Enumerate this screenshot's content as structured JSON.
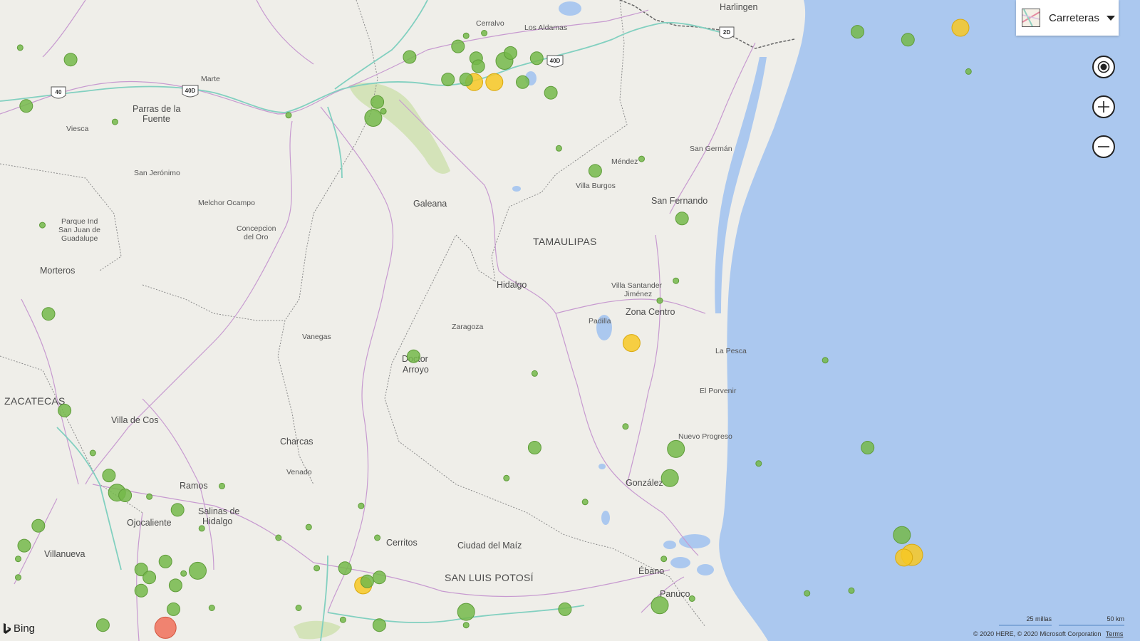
{
  "colors": {
    "water": "#abc8ef",
    "land": "#efeee9",
    "highway": "#82d0c0",
    "road": "#c79ad0",
    "state_border": "#8a8a8a",
    "marker_green": "#74b84a",
    "marker_yellow": "#f7c824",
    "marker_red": "#f0705a",
    "park": "#cfe0b0"
  },
  "map_style": {
    "label": "Carreteras",
    "icon": "road-map-thumbnail-icon"
  },
  "nav_controls": [
    {
      "name": "locate-me-button",
      "icon": "target-icon"
    },
    {
      "name": "zoom-in-button",
      "icon": "plus-icon"
    },
    {
      "name": "zoom-out-button",
      "icon": "minus-icon"
    }
  ],
  "labels": {
    "states": [
      "TAMAULIPAS",
      "ZACATECAS",
      "SAN LUIS POTOSÍ"
    ],
    "cities": [
      "Harlingen",
      "Parras de la",
      "Fuente",
      "Galeana",
      "San Fernando",
      "Hidalgo",
      "Zona Centro",
      "Morteros",
      "Doctor",
      "Arroyo",
      "Villa de Cos",
      "Charcas",
      "Ramos",
      "Salinas de",
      "Hidalgo",
      "Ojocaliente",
      "Villanueva",
      "Cerritos",
      "Ciudad del Maíz",
      "Ébano",
      "Panuco",
      "González"
    ],
    "towns": [
      "Cerralvo",
      "Los Aldamas",
      "Marte",
      "Viesca",
      "San Jerónimo",
      "Melchor Ocampo",
      "Parque Ind",
      "San Juan de",
      "Guadalupe",
      "Concepcion",
      "del Oro",
      "Méndez",
      "Villa Burgos",
      "San Germán",
      "Villa Santander",
      "Jiménez",
      "Padilla",
      "Vanegas",
      "Zaragoza",
      "La Pesca",
      "El Porvenir",
      "Nuevo Progreso",
      "Venado"
    ]
  },
  "shields": [
    "40",
    "40D",
    "40D",
    "2D"
  ],
  "markers": [
    {
      "lat": 26.21,
      "lon": -97.69,
      "size": 3,
      "level": "yellow"
    },
    {
      "lat": 26.12,
      "lon": -97.95,
      "size": 2,
      "level": "green"
    },
    {
      "lat": 26.18,
      "lon": -98.2,
      "size": 2,
      "level": "green"
    },
    {
      "lat": 25.88,
      "lon": -97.65,
      "size": 1,
      "level": "green"
    },
    {
      "lat": 25.8,
      "lon": -100.1,
      "size": 3,
      "level": "yellow"
    },
    {
      "lat": 25.8,
      "lon": -100.0,
      "size": 3,
      "level": "yellow"
    },
    {
      "lat": 25.96,
      "lon": -99.95,
      "size": 3,
      "level": "green"
    },
    {
      "lat": 26.02,
      "lon": -99.92,
      "size": 2,
      "level": "green"
    },
    {
      "lat": 26.07,
      "lon": -100.18,
      "size": 2,
      "level": "green"
    },
    {
      "lat": 26.15,
      "lon": -100.14,
      "size": 1,
      "level": "green"
    },
    {
      "lat": 26.17,
      "lon": -100.05,
      "size": 1,
      "level": "green"
    },
    {
      "lat": 25.98,
      "lon": -100.09,
      "size": 2,
      "level": "green"
    },
    {
      "lat": 25.92,
      "lon": -100.08,
      "size": 2,
      "level": "green"
    },
    {
      "lat": 25.82,
      "lon": -100.23,
      "size": 2,
      "level": "green"
    },
    {
      "lat": 25.82,
      "lon": -100.14,
      "size": 2,
      "level": "green"
    },
    {
      "lat": 25.8,
      "lon": -99.86,
      "size": 2,
      "level": "green"
    },
    {
      "lat": 25.72,
      "lon": -99.72,
      "size": 2,
      "level": "green"
    },
    {
      "lat": 25.98,
      "lon": -99.79,
      "size": 2,
      "level": "green"
    },
    {
      "lat": 25.99,
      "lon": -100.42,
      "size": 2,
      "level": "green"
    },
    {
      "lat": 25.65,
      "lon": -100.58,
      "size": 2,
      "level": "green"
    },
    {
      "lat": 25.53,
      "lon": -100.6,
      "size": 3,
      "level": "green"
    },
    {
      "lat": 25.58,
      "lon": -100.55,
      "size": 1,
      "level": "green"
    },
    {
      "lat": 25.3,
      "lon": -99.68,
      "size": 1,
      "level": "green"
    },
    {
      "lat": 25.13,
      "lon": -99.5,
      "size": 2,
      "level": "green"
    },
    {
      "lat": 25.22,
      "lon": -99.27,
      "size": 1,
      "level": "green"
    },
    {
      "lat": 24.77,
      "lon": -99.07,
      "size": 2,
      "level": "green"
    },
    {
      "lat": 25.97,
      "lon": -102.1,
      "size": 2,
      "level": "green"
    },
    {
      "lat": 25.62,
      "lon": -102.32,
      "size": 2,
      "level": "green"
    },
    {
      "lat": 25.5,
      "lon": -101.88,
      "size": 1,
      "level": "green"
    },
    {
      "lat": 26.06,
      "lon": -102.35,
      "size": 1,
      "level": "green"
    },
    {
      "lat": 25.55,
      "lon": -101.02,
      "size": 1,
      "level": "green"
    },
    {
      "lat": 24.72,
      "lon": -102.24,
      "size": 1,
      "level": "green"
    },
    {
      "lat": 24.05,
      "lon": -102.21,
      "size": 2,
      "level": "green"
    },
    {
      "lat": 23.32,
      "lon": -102.13,
      "size": 2,
      "level": "green"
    },
    {
      "lat": 23.0,
      "lon": -101.99,
      "size": 1,
      "level": "green"
    },
    {
      "lat": 22.83,
      "lon": -101.91,
      "size": 2,
      "level": "green"
    },
    {
      "lat": 22.7,
      "lon": -101.87,
      "size": 3,
      "level": "green"
    },
    {
      "lat": 22.68,
      "lon": -101.83,
      "size": 2,
      "level": "green"
    },
    {
      "lat": 22.67,
      "lon": -101.71,
      "size": 1,
      "level": "green"
    },
    {
      "lat": 22.75,
      "lon": -101.35,
      "size": 1,
      "level": "green"
    },
    {
      "lat": 22.57,
      "lon": -101.57,
      "size": 2,
      "level": "green"
    },
    {
      "lat": 22.45,
      "lon": -102.26,
      "size": 2,
      "level": "green"
    },
    {
      "lat": 22.3,
      "lon": -102.33,
      "size": 2,
      "level": "green"
    },
    {
      "lat": 22.2,
      "lon": -102.36,
      "size": 1,
      "level": "green"
    },
    {
      "lat": 22.43,
      "lon": -101.45,
      "size": 1,
      "level": "green"
    },
    {
      "lat": 22.18,
      "lon": -101.63,
      "size": 2,
      "level": "green"
    },
    {
      "lat": 22.11,
      "lon": -101.47,
      "size": 3,
      "level": "green"
    },
    {
      "lat": 22.09,
      "lon": -101.54,
      "size": 1,
      "level": "green"
    },
    {
      "lat": 22.12,
      "lon": -101.75,
      "size": 2,
      "level": "green"
    },
    {
      "lat": 22.06,
      "lon": -101.71,
      "size": 2,
      "level": "green"
    },
    {
      "lat": 21.96,
      "lon": -101.75,
      "size": 2,
      "level": "green"
    },
    {
      "lat": 22.0,
      "lon": -101.58,
      "size": 2,
      "level": "green"
    },
    {
      "lat": 21.83,
      "lon": -101.4,
      "size": 1,
      "level": "green"
    },
    {
      "lat": 21.82,
      "lon": -101.59,
      "size": 2,
      "level": "green"
    },
    {
      "lat": 21.7,
      "lon": -101.94,
      "size": 2,
      "level": "green"
    },
    {
      "lat": 21.68,
      "lon": -101.63,
      "size": 4,
      "level": "red"
    },
    {
      "lat": 22.06,
      "lon": -102.36,
      "size": 1,
      "level": "green"
    },
    {
      "lat": 22.44,
      "lon": -100.92,
      "size": 1,
      "level": "green"
    },
    {
      "lat": 22.36,
      "lon": -101.07,
      "size": 1,
      "level": "green"
    },
    {
      "lat": 22.13,
      "lon": -100.74,
      "size": 2,
      "level": "green"
    },
    {
      "lat": 22.0,
      "lon": -100.65,
      "size": 3,
      "level": "yellow"
    },
    {
      "lat": 22.03,
      "lon": -100.63,
      "size": 2,
      "level": "green"
    },
    {
      "lat": 22.06,
      "lon": -100.57,
      "size": 2,
      "level": "green"
    },
    {
      "lat": 22.13,
      "lon": -100.88,
      "size": 1,
      "level": "green"
    },
    {
      "lat": 21.83,
      "lon": -100.97,
      "size": 1,
      "level": "green"
    },
    {
      "lat": 21.7,
      "lon": -100.57,
      "size": 2,
      "level": "green"
    },
    {
      "lat": 21.74,
      "lon": -100.75,
      "size": 1,
      "level": "green"
    },
    {
      "lat": 22.6,
      "lon": -100.66,
      "size": 1,
      "level": "green"
    },
    {
      "lat": 22.36,
      "lon": -100.58,
      "size": 1,
      "level": "green"
    },
    {
      "lat": 23.73,
      "lon": -100.4,
      "size": 2,
      "level": "green"
    },
    {
      "lat": 23.6,
      "lon": -99.8,
      "size": 1,
      "level": "green"
    },
    {
      "lat": 23.83,
      "lon": -99.32,
      "size": 3,
      "level": "yellow"
    },
    {
      "lat": 24.15,
      "lon": -99.18,
      "size": 1,
      "level": "green"
    },
    {
      "lat": 24.3,
      "lon": -99.1,
      "size": 1,
      "level": "green"
    },
    {
      "lat": 23.2,
      "lon": -99.35,
      "size": 1,
      "level": "green"
    },
    {
      "lat": 23.04,
      "lon": -99.8,
      "size": 2,
      "level": "green"
    },
    {
      "lat": 23.03,
      "lon": -99.1,
      "size": 3,
      "level": "green"
    },
    {
      "lat": 22.81,
      "lon": -99.13,
      "size": 3,
      "level": "green"
    },
    {
      "lat": 22.92,
      "lon": -98.69,
      "size": 1,
      "level": "green"
    },
    {
      "lat": 22.81,
      "lon": -99.94,
      "size": 1,
      "level": "green"
    },
    {
      "lat": 22.63,
      "lon": -99.55,
      "size": 1,
      "level": "green"
    },
    {
      "lat": 22.2,
      "lon": -99.16,
      "size": 1,
      "level": "green"
    },
    {
      "lat": 21.9,
      "lon": -99.02,
      "size": 1,
      "level": "green"
    },
    {
      "lat": 21.85,
      "lon": -99.18,
      "size": 3,
      "level": "green"
    },
    {
      "lat": 21.82,
      "lon": -99.65,
      "size": 2,
      "level": "green"
    },
    {
      "lat": 21.8,
      "lon": -100.14,
      "size": 3,
      "level": "green"
    },
    {
      "lat": 21.7,
      "lon": -100.14,
      "size": 1,
      "level": "green"
    },
    {
      "lat": 23.04,
      "lon": -98.15,
      "size": 2,
      "level": "green"
    },
    {
      "lat": 23.7,
      "lon": -98.36,
      "size": 1,
      "level": "green"
    },
    {
      "lat": 22.38,
      "lon": -97.98,
      "size": 3,
      "level": "green"
    },
    {
      "lat": 22.23,
      "lon": -97.93,
      "size": 4,
      "level": "yellow"
    },
    {
      "lat": 22.21,
      "lon": -97.97,
      "size": 3,
      "level": "yellow"
    },
    {
      "lat": 21.94,
      "lon": -98.45,
      "size": 1,
      "level": "green"
    },
    {
      "lat": 21.96,
      "lon": -98.23,
      "size": 1,
      "level": "green"
    }
  ],
  "attribution": {
    "logo": "Bing",
    "scale_miles": "25 millas",
    "scale_km": "50 km",
    "copyright": "© 2020 HERE, © 2020 Microsoft Corporation",
    "terms": "Terms"
  }
}
